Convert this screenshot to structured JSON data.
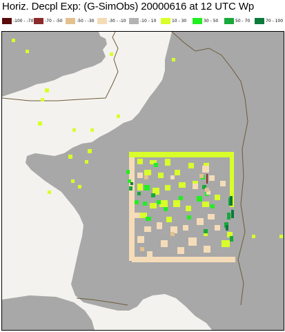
{
  "title": "Horiz. Decpl Exp: (G-SimObs) 20000616 at 12 UTC Wp",
  "legend": [
    {
      "label": "-100 - -70",
      "color": "#5a0a0a"
    },
    {
      "label": "-70 - -50",
      "color": "#8b2a2a"
    },
    {
      "label": "-50 - -30",
      "color": "#e3c18f"
    },
    {
      "label": "-30 - -10",
      "color": "#f5dcb8"
    },
    {
      "label": "-10 - 10",
      "color": "#b3b3b3"
    },
    {
      "label": "10 - 30",
      "color": "#d8ff2a"
    },
    {
      "label": "30 - 50",
      "color": "#22ee22"
    },
    {
      "label": "50 - 70",
      "color": "#19a83a"
    },
    {
      "label": "70 - 100",
      "color": "#0c7a3a"
    }
  ],
  "colors": {
    "sea": "#f4f2ee",
    "land": "#a8a8a8",
    "border": "#6b5a3a",
    "neutral": "#b3b3b3",
    "positive_low": "#d8ff2a",
    "positive_mid": "#22ee22",
    "positive_high": "#19a83a",
    "positive_max": "#0c7a3a",
    "negative_light": "#f5dcb8",
    "negative_mid": "#e3c18f",
    "negative_strong": "#8b2a2a"
  }
}
